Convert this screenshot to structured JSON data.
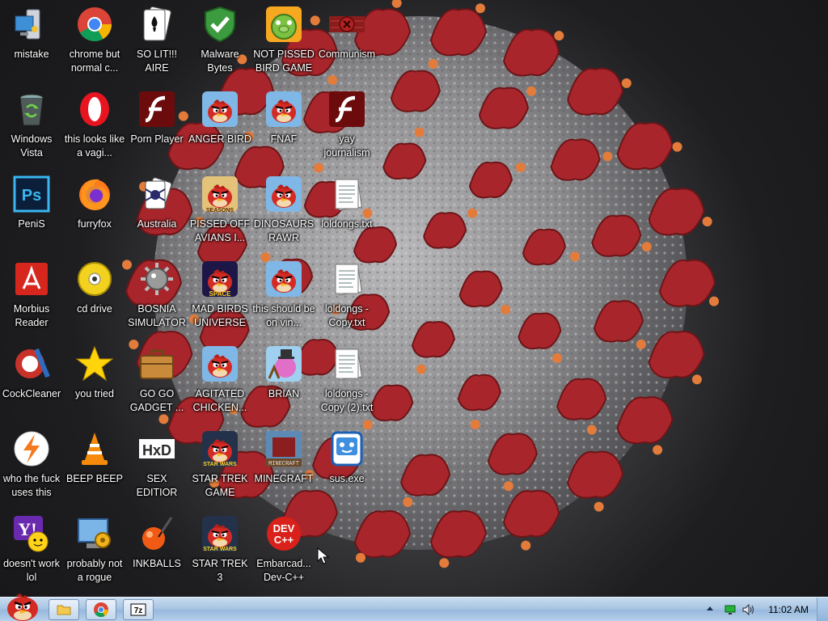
{
  "desktop": {
    "icons": [
      {
        "label": "mistake",
        "icon": "computer-icon"
      },
      {
        "label": "chrome but normal c...",
        "icon": "chrome-icon"
      },
      {
        "label": "SO LIT!!! AIRE",
        "icon": "solitaire-icon"
      },
      {
        "label": "Malware Bytes",
        "icon": "shield-check-icon"
      },
      {
        "label": "NOT PISSED BIRD GAME",
        "icon": "green-pig-icon"
      },
      {
        "label": "Communism",
        "icon": "red-emblem-icon"
      },
      {
        "label": "Windows Vista",
        "icon": "recycle-bin-icon"
      },
      {
        "label": "this looks like a vagi...",
        "icon": "opera-icon"
      },
      {
        "label": "Porn Player",
        "icon": "flash-icon"
      },
      {
        "label": "ANGER BIRD",
        "icon": "angry-bird-icon"
      },
      {
        "label": "FNAF",
        "icon": "angry-bird-icon"
      },
      {
        "label": "yay journalism",
        "icon": "flash-icon"
      },
      {
        "label": "PeniS",
        "icon": "photoshop-icon"
      },
      {
        "label": "furryfox",
        "icon": "firefox-icon"
      },
      {
        "label": "Australia",
        "icon": "spider-solitaire-icon"
      },
      {
        "label": "PISSED OFF AVIANS I...",
        "icon": "angry-birds-seasons-icon"
      },
      {
        "label": "DINOSAURS RAWR",
        "icon": "angry-bird-icon"
      },
      {
        "label": "loldongs.txt",
        "icon": "text-file-icon"
      },
      {
        "label": "Morbius Reader",
        "icon": "acrobat-icon"
      },
      {
        "label": "cd drive",
        "icon": "cd-icon"
      },
      {
        "label": "BOSNIA SIMULATOR",
        "icon": "mine-icon"
      },
      {
        "label": "MAD BIRDS UNIVERSE",
        "icon": "angry-birds-space-icon"
      },
      {
        "label": "this should be on vin...",
        "icon": "angry-bird-icon"
      },
      {
        "label": "loldongs - Copy.txt",
        "icon": "text-file-icon"
      },
      {
        "label": "CockCleaner",
        "icon": "ccleaner-icon"
      },
      {
        "label": "you tried",
        "icon": "star-icon"
      },
      {
        "label": "GO GO GADGET ...",
        "icon": "briefcase-icon"
      },
      {
        "label": "AGITATED CHICKEN...",
        "icon": "angry-bird-icon"
      },
      {
        "label": "BRIAN",
        "icon": "slingshot-bird-icon"
      },
      {
        "label": "loldongs - Copy (2).txt",
        "icon": "text-file-icon"
      },
      {
        "label": "who the fuck uses this",
        "icon": "lightning-icon"
      },
      {
        "label": "BEEP BEEP",
        "icon": "vlc-cone-icon"
      },
      {
        "label": "SEX EDITIOR",
        "icon": "hxd-icon"
      },
      {
        "label": "STAR TREK GAME",
        "icon": "star-wars-bird-icon"
      },
      {
        "label": "MINECRAFT",
        "icon": "minecraft-icon"
      },
      {
        "label": "sus.exe",
        "icon": "robot-icon"
      },
      {
        "label": "doesn't work lol",
        "icon": "yahoo-icon"
      },
      {
        "label": "probably not a rogue",
        "icon": "gear-monitor-icon"
      },
      {
        "label": "INKBALLS",
        "icon": "ink-ball-icon"
      },
      {
        "label": "STAR TREK 3",
        "icon": "star-wars-bird-icon"
      },
      {
        "label": "Embarcad... Dev-C++",
        "icon": "devcpp-icon"
      }
    ]
  },
  "taskbar": {
    "start_icon": "angry-bird-start-icon",
    "pinned": [
      {
        "name": "explorer",
        "icon": "folder-icon"
      },
      {
        "name": "chrome",
        "icon": "chrome-icon"
      },
      {
        "name": "7zip",
        "icon": "7zip-icon"
      }
    ],
    "tray": {
      "clock": "11:02 AM"
    }
  },
  "colors": {
    "taskbar_top": "#c9dcef",
    "taskbar_bottom": "#97b9dd",
    "virus_red": "#a8262b",
    "virus_gray": "#9a9a9c"
  }
}
